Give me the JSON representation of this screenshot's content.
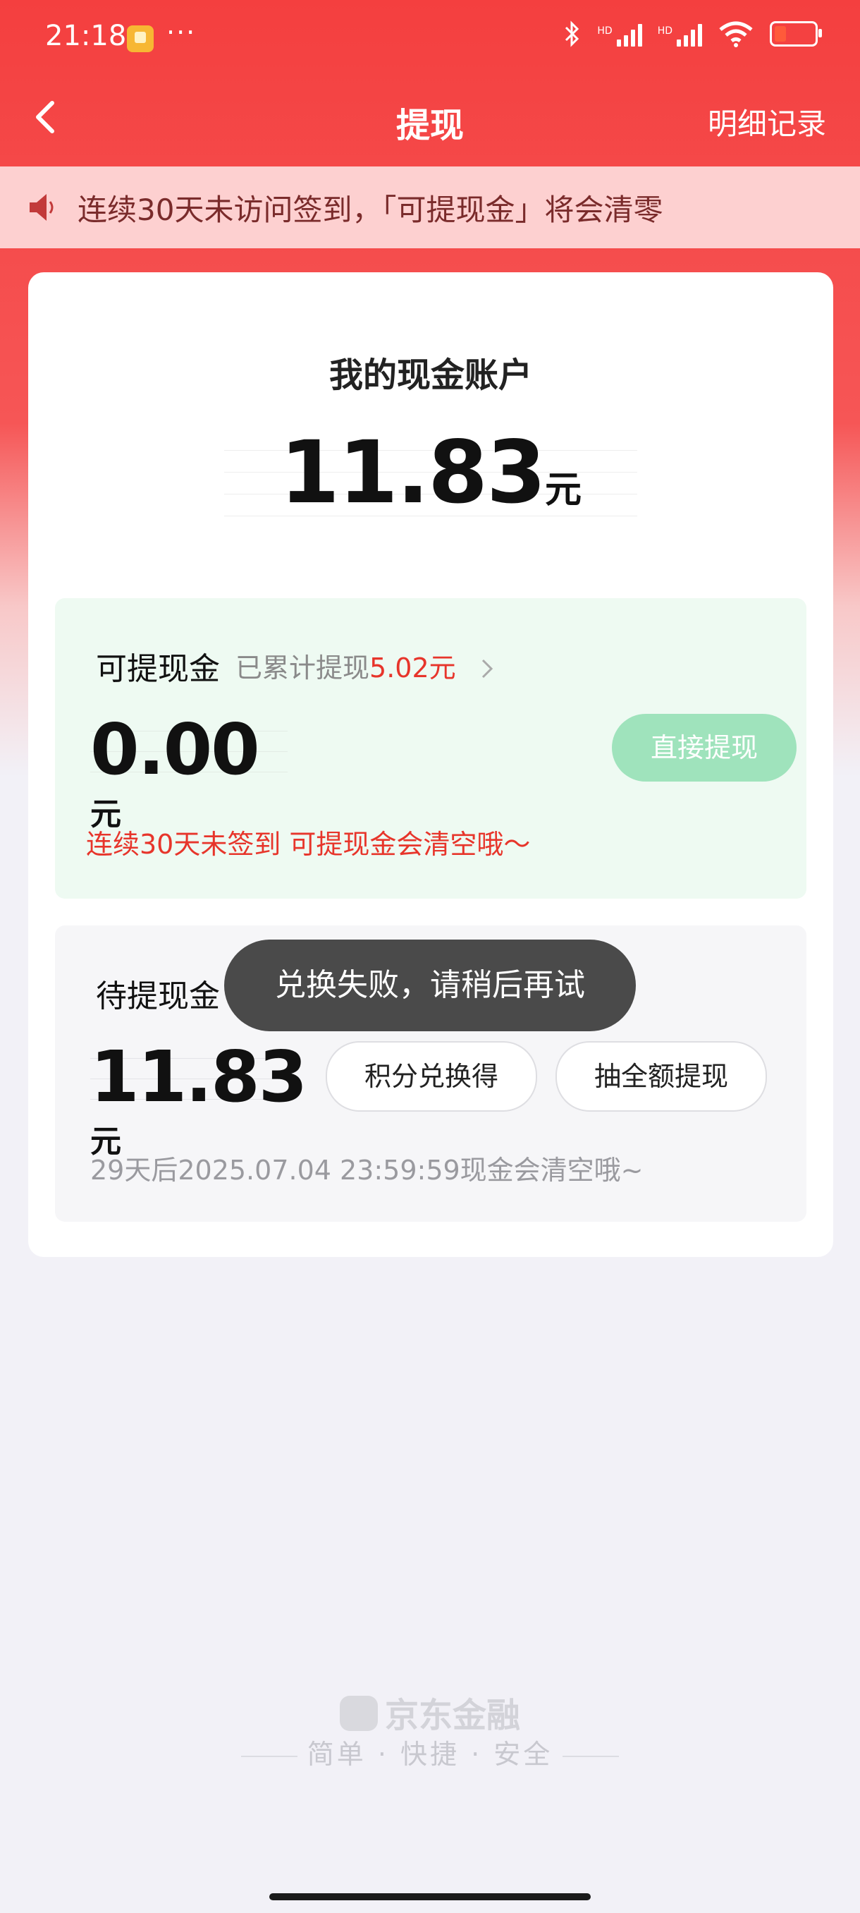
{
  "status_bar": {
    "time": "21:18",
    "dots": "···",
    "hd1": "HD",
    "hd2": "HD",
    "battery_level": 0.2
  },
  "header": {
    "title": "提现",
    "detail_link": "明细记录"
  },
  "notice": {
    "text": "连续30天未访问签到，「可提现金」将会清零"
  },
  "account": {
    "title": "我的现金账户",
    "amount": "11.83",
    "unit": "元"
  },
  "withdrawable": {
    "label": "可提现金",
    "total_prefix": "已累计提现",
    "total_amount": "5.02元",
    "amount": "0.00",
    "unit": "元",
    "button": "直接提现",
    "warning": "连续30天未签到 可提现金会清空哦～"
  },
  "pending": {
    "label": "待提现金",
    "amount": "11.83",
    "unit": "元",
    "button_exchange": "积分兑换得",
    "button_lottery": "抽全额提现",
    "expire_note": "29天后2025.07.04 23:59:59现金会清空哦~"
  },
  "toast": {
    "text": "兑换失败，请稍后再试"
  },
  "footer": {
    "brand": "京东金融",
    "slogan": "简单 · 快捷 · 安全"
  },
  "colors": {
    "brand_red": "#f43f3f",
    "accent_red": "#e7352b",
    "button_green": "#9fe3bc"
  }
}
